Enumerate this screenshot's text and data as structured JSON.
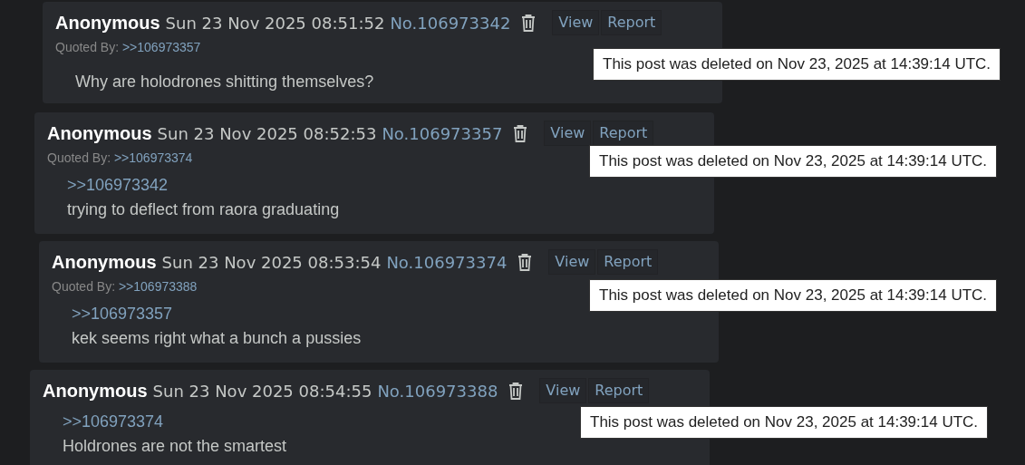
{
  "posts": [
    {
      "name": "Anonymous",
      "date": "Sun 23 Nov 2025 08:51:52",
      "number": "No.106973342",
      "actions": [
        "View",
        "Report"
      ],
      "quoted_by": {
        "label": "Quoted By:",
        "links": [
          ">>106973357"
        ]
      },
      "body": [
        {
          "kind": "text",
          "text": "Why are holodrones shitting themselves?"
        }
      ],
      "notice": "This post was deleted on Nov 23, 2025 at 14:39:14 UTC."
    },
    {
      "name": "Anonymous",
      "date": "Sun 23 Nov 2025 08:52:53",
      "number": "No.106973357",
      "actions": [
        "View",
        "Report"
      ],
      "quoted_by": {
        "label": "Quoted By:",
        "links": [
          ">>106973374"
        ]
      },
      "body": [
        {
          "kind": "quote",
          "text": ">>106973342"
        },
        {
          "kind": "text",
          "text": "trying to deflect from raora graduating"
        }
      ],
      "notice": "This post was deleted on Nov 23, 2025 at 14:39:14 UTC."
    },
    {
      "name": "Anonymous",
      "date": "Sun 23 Nov 2025 08:53:54",
      "number": "No.106973374",
      "actions": [
        "View",
        "Report"
      ],
      "quoted_by": {
        "label": "Quoted By:",
        "links": [
          ">>106973388"
        ]
      },
      "body": [
        {
          "kind": "quote",
          "text": ">>106973357"
        },
        {
          "kind": "text",
          "text": "kek seems right what a bunch a pussies"
        }
      ],
      "notice": "This post was deleted on Nov 23, 2025 at 14:39:14 UTC."
    },
    {
      "name": "Anonymous",
      "date": "Sun 23 Nov 2025 08:54:55",
      "number": "No.106973388",
      "actions": [
        "View",
        "Report"
      ],
      "body": [
        {
          "kind": "quote",
          "text": ">>106973374"
        },
        {
          "kind": "text",
          "text": "Holdrones are not the smartest"
        }
      ],
      "notice": "This post was deleted on Nov 23, 2025 at 14:39:14 UTC."
    }
  ]
}
